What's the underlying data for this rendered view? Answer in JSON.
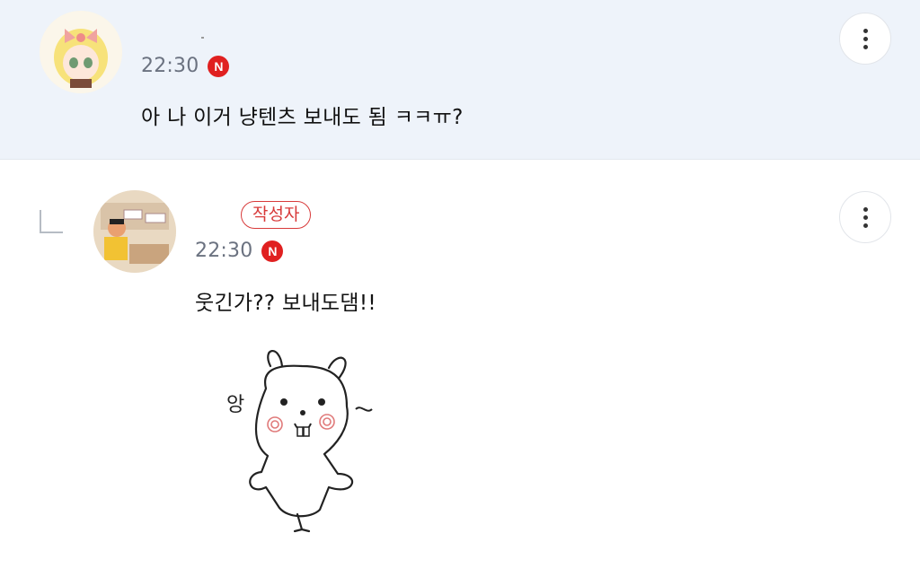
{
  "comments": [
    {
      "time": "22:30",
      "badge": "N",
      "text": "아 나 이거 냥텐츠 보내도 됨 ㅋㅋㅠ?",
      "avatar_icon": "anime-girl-avatar"
    },
    {
      "time": "22:30",
      "badge": "N",
      "author_label": "작성자",
      "text": "웃긴가?? 보내도댐!!",
      "avatar_icon": "cartoon-avatar",
      "sticker_text": "앙"
    }
  ],
  "colors": {
    "highlight_bg": "#eef3fa",
    "badge_red": "#e02020",
    "author_red": "#d83a3a",
    "time_gray": "#6b7280"
  }
}
